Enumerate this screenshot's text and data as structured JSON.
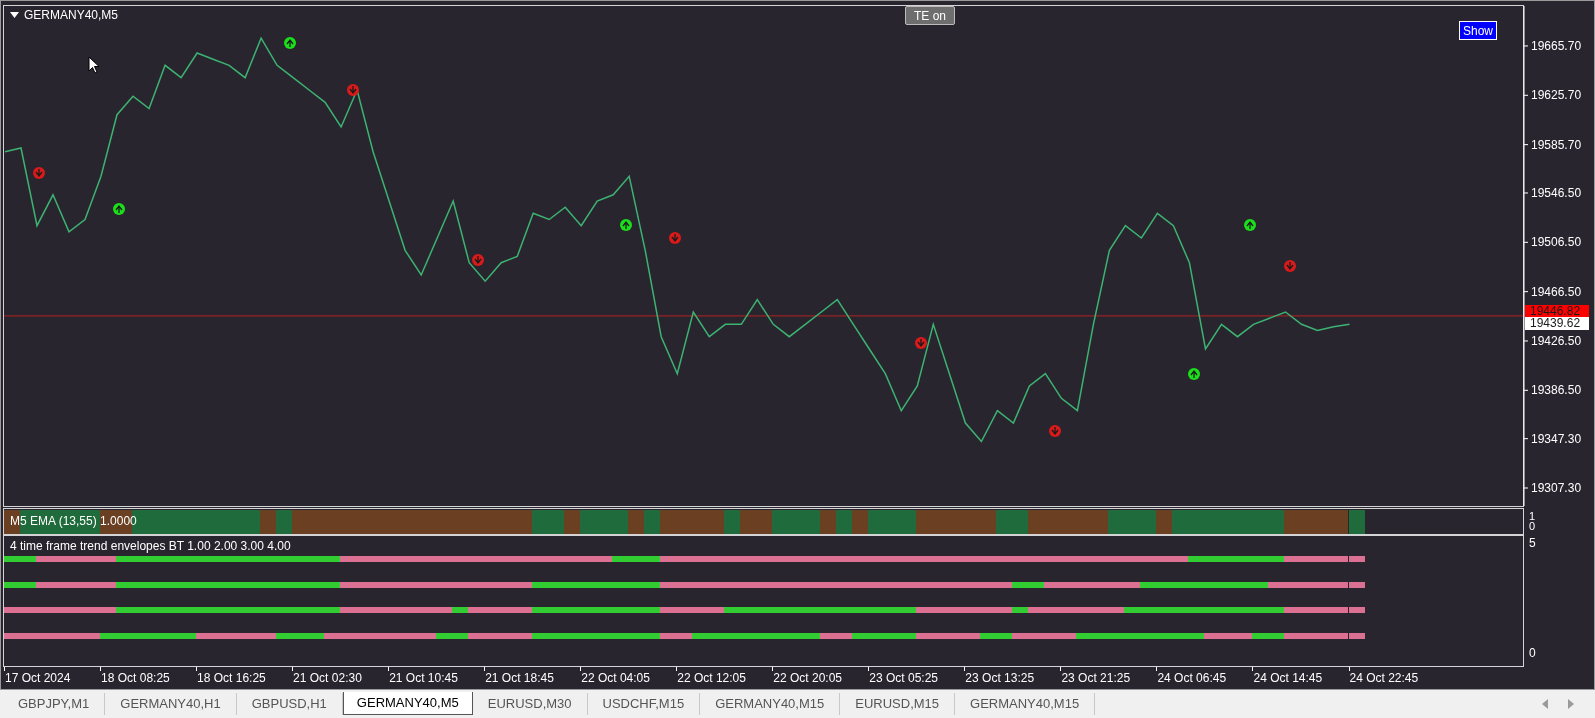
{
  "chart_window": {
    "title": "GERMANY40,M5",
    "te_button": "TE on",
    "show_button": "Show",
    "price_pane": {
      "ask_label": "19439.62",
      "chart_data": {
        "type": "line",
        "ylim": [
          19292.7,
          19698.1
        ],
        "yticks": [
          {
            "value": 19665.7,
            "label": "19665.70"
          },
          {
            "value": 19625.7,
            "label": "19625.70"
          },
          {
            "value": 19585.7,
            "label": "19585.70"
          },
          {
            "value": 19546.5,
            "label": "19546.50"
          },
          {
            "value": 19506.5,
            "label": "19506.50"
          },
          {
            "value": 19466.5,
            "label": "19466.50"
          },
          {
            "value": 19426.5,
            "label": "19426.50"
          },
          {
            "value": 19386.5,
            "label": "19386.50"
          },
          {
            "value": 19347.3,
            "label": "19347.30"
          },
          {
            "value": 19307.3,
            "label": "19307.30"
          }
        ],
        "series": [
          {
            "color": "#3cb371",
            "values": [
              19580,
              19583,
              19520,
              19545,
              19515,
              19525,
              19560,
              19610,
              19625,
              19615,
              19650,
              19640,
              19660,
              19655,
              19650,
              19640,
              19672,
              19650,
              19640,
              19630,
              19620,
              19600,
              19630,
              19580,
              19540,
              19500,
              19480,
              19510,
              19540,
              19490,
              19475,
              19490,
              19495,
              19530,
              19525,
              19535,
              19520,
              19540,
              19545,
              19560,
              19500,
              19430,
              19400,
              19450,
              19430,
              19440,
              19440,
              19460,
              19440,
              19430,
              19440,
              19450,
              19460,
              19440,
              19420,
              19400,
              19370,
              19390,
              19440,
              19400,
              19360,
              19345,
              19370,
              19360,
              19390,
              19400,
              19380,
              19370,
              19440,
              19500,
              19520,
              19510,
              19530,
              19520,
              19490,
              19420,
              19440,
              19430,
              19440,
              19445,
              19450,
              19440,
              19435,
              19438,
              19440
            ]
          }
        ],
        "ref_lines": [
          {
            "axis": "y",
            "value": 19446.82,
            "label": "19446.82"
          }
        ]
      }
    },
    "ema_pane": {
      "title": "M5 EMA (13,55) 1.0000",
      "scale": [
        "1",
        "0"
      ],
      "cells": [
        {
          "color": "#6b3f22"
        },
        {
          "color": "#1f6b3b"
        },
        {
          "color": "#1f6b3b"
        },
        {
          "color": "#1f6b3b"
        },
        {
          "color": "#1f6b3b"
        },
        {
          "color": "#1f6b3b"
        },
        {
          "color": "#6b3f22"
        },
        {
          "color": "#6b3f22"
        },
        {
          "color": "#1f6b3b"
        },
        {
          "color": "#1f6b3b"
        },
        {
          "color": "#1f6b3b"
        },
        {
          "color": "#1f6b3b"
        },
        {
          "color": "#1f6b3b"
        },
        {
          "color": "#1f6b3b"
        },
        {
          "color": "#1f6b3b"
        },
        {
          "color": "#1f6b3b"
        },
        {
          "color": "#6b3f22"
        },
        {
          "color": "#1f6b3b"
        },
        {
          "color": "#6b3f22"
        },
        {
          "color": "#6b3f22"
        },
        {
          "color": "#6b3f22"
        },
        {
          "color": "#6b3f22"
        },
        {
          "color": "#6b3f22"
        },
        {
          "color": "#6b3f22"
        },
        {
          "color": "#6b3f22"
        },
        {
          "color": "#6b3f22"
        },
        {
          "color": "#6b3f22"
        },
        {
          "color": "#6b3f22"
        },
        {
          "color": "#6b3f22"
        },
        {
          "color": "#6b3f22"
        },
        {
          "color": "#6b3f22"
        },
        {
          "color": "#6b3f22"
        },
        {
          "color": "#6b3f22"
        },
        {
          "color": "#1f6b3b"
        },
        {
          "color": "#1f6b3b"
        },
        {
          "color": "#6b3f22"
        },
        {
          "color": "#1f6b3b"
        },
        {
          "color": "#1f6b3b"
        },
        {
          "color": "#1f6b3b"
        },
        {
          "color": "#6b3f22"
        },
        {
          "color": "#1f6b3b"
        },
        {
          "color": "#6b3f22"
        },
        {
          "color": "#6b3f22"
        },
        {
          "color": "#6b3f22"
        },
        {
          "color": "#6b3f22"
        },
        {
          "color": "#1f6b3b"
        },
        {
          "color": "#6b3f22"
        },
        {
          "color": "#6b3f22"
        },
        {
          "color": "#1f6b3b"
        },
        {
          "color": "#1f6b3b"
        },
        {
          "color": "#1f6b3b"
        },
        {
          "color": "#6b3f22"
        },
        {
          "color": "#1f6b3b"
        },
        {
          "color": "#6b3f22"
        },
        {
          "color": "#1f6b3b"
        },
        {
          "color": "#1f6b3b"
        },
        {
          "color": "#1f6b3b"
        },
        {
          "color": "#6b3f22"
        },
        {
          "color": "#6b3f22"
        },
        {
          "color": "#6b3f22"
        },
        {
          "color": "#6b3f22"
        },
        {
          "color": "#6b3f22"
        },
        {
          "color": "#1f6b3b"
        },
        {
          "color": "#1f6b3b"
        },
        {
          "color": "#6b3f22"
        },
        {
          "color": "#6b3f22"
        },
        {
          "color": "#6b3f22"
        },
        {
          "color": "#6b3f22"
        },
        {
          "color": "#6b3f22"
        },
        {
          "color": "#1f6b3b"
        },
        {
          "color": "#1f6b3b"
        },
        {
          "color": "#1f6b3b"
        },
        {
          "color": "#6b3f22"
        },
        {
          "color": "#1f6b3b"
        },
        {
          "color": "#1f6b3b"
        },
        {
          "color": "#1f6b3b"
        },
        {
          "color": "#1f6b3b"
        },
        {
          "color": "#1f6b3b"
        },
        {
          "color": "#1f6b3b"
        },
        {
          "color": "#1f6b3b"
        },
        {
          "color": "#6b3f22"
        },
        {
          "color": "#6b3f22"
        },
        {
          "color": "#6b3f22"
        },
        {
          "color": "#6b3f22"
        },
        {
          "color": "#1f6b3b"
        }
      ]
    },
    "trend_pane": {
      "title": "4 time frame trend envelopes BT 1.00 2.00 3.00 4.00",
      "scale": [
        "5",
        "0"
      ],
      "lines": [
        {
          "cells": [
            {
              "color": "#32cd32"
            },
            {
              "color": "#32cd32"
            },
            {
              "color": "#db7093"
            },
            {
              "color": "#db7093"
            },
            {
              "color": "#db7093"
            },
            {
              "color": "#db7093"
            },
            {
              "color": "#db7093"
            },
            {
              "color": "#32cd32"
            },
            {
              "color": "#32cd32"
            },
            {
              "color": "#32cd32"
            },
            {
              "color": "#32cd32"
            },
            {
              "color": "#32cd32"
            },
            {
              "color": "#32cd32"
            },
            {
              "color": "#32cd32"
            },
            {
              "color": "#32cd32"
            },
            {
              "color": "#32cd32"
            },
            {
              "color": "#32cd32"
            },
            {
              "color": "#32cd32"
            },
            {
              "color": "#32cd32"
            },
            {
              "color": "#32cd32"
            },
            {
              "color": "#32cd32"
            },
            {
              "color": "#db7093"
            },
            {
              "color": "#db7093"
            },
            {
              "color": "#db7093"
            },
            {
              "color": "#db7093"
            },
            {
              "color": "#db7093"
            },
            {
              "color": "#db7093"
            },
            {
              "color": "#db7093"
            },
            {
              "color": "#db7093"
            },
            {
              "color": "#db7093"
            },
            {
              "color": "#db7093"
            },
            {
              "color": "#db7093"
            },
            {
              "color": "#db7093"
            },
            {
              "color": "#db7093"
            },
            {
              "color": "#db7093"
            },
            {
              "color": "#db7093"
            },
            {
              "color": "#db7093"
            },
            {
              "color": "#db7093"
            },
            {
              "color": "#32cd32"
            },
            {
              "color": "#32cd32"
            },
            {
              "color": "#32cd32"
            },
            {
              "color": "#db7093"
            },
            {
              "color": "#db7093"
            },
            {
              "color": "#db7093"
            },
            {
              "color": "#db7093"
            },
            {
              "color": "#db7093"
            },
            {
              "color": "#db7093"
            },
            {
              "color": "#db7093"
            },
            {
              "color": "#db7093"
            },
            {
              "color": "#db7093"
            },
            {
              "color": "#db7093"
            },
            {
              "color": "#db7093"
            },
            {
              "color": "#db7093"
            },
            {
              "color": "#db7093"
            },
            {
              "color": "#db7093"
            },
            {
              "color": "#db7093"
            },
            {
              "color": "#db7093"
            },
            {
              "color": "#db7093"
            },
            {
              "color": "#db7093"
            },
            {
              "color": "#db7093"
            },
            {
              "color": "#db7093"
            },
            {
              "color": "#db7093"
            },
            {
              "color": "#db7093"
            },
            {
              "color": "#db7093"
            },
            {
              "color": "#db7093"
            },
            {
              "color": "#db7093"
            },
            {
              "color": "#db7093"
            },
            {
              "color": "#db7093"
            },
            {
              "color": "#db7093"
            },
            {
              "color": "#db7093"
            },
            {
              "color": "#db7093"
            },
            {
              "color": "#db7093"
            },
            {
              "color": "#db7093"
            },
            {
              "color": "#db7093"
            },
            {
              "color": "#32cd32"
            },
            {
              "color": "#32cd32"
            },
            {
              "color": "#32cd32"
            },
            {
              "color": "#32cd32"
            },
            {
              "color": "#32cd32"
            },
            {
              "color": "#32cd32"
            },
            {
              "color": "#db7093"
            },
            {
              "color": "#db7093"
            },
            {
              "color": "#db7093"
            },
            {
              "color": "#db7093"
            },
            {
              "color": "#db7093"
            }
          ]
        },
        {
          "cells": [
            {
              "color": "#32cd32"
            },
            {
              "color": "#32cd32"
            },
            {
              "color": "#db7093"
            },
            {
              "color": "#db7093"
            },
            {
              "color": "#db7093"
            },
            {
              "color": "#db7093"
            },
            {
              "color": "#db7093"
            },
            {
              "color": "#32cd32"
            },
            {
              "color": "#32cd32"
            },
            {
              "color": "#32cd32"
            },
            {
              "color": "#32cd32"
            },
            {
              "color": "#32cd32"
            },
            {
              "color": "#32cd32"
            },
            {
              "color": "#32cd32"
            },
            {
              "color": "#32cd32"
            },
            {
              "color": "#32cd32"
            },
            {
              "color": "#32cd32"
            },
            {
              "color": "#32cd32"
            },
            {
              "color": "#32cd32"
            },
            {
              "color": "#32cd32"
            },
            {
              "color": "#32cd32"
            },
            {
              "color": "#db7093"
            },
            {
              "color": "#db7093"
            },
            {
              "color": "#db7093"
            },
            {
              "color": "#db7093"
            },
            {
              "color": "#db7093"
            },
            {
              "color": "#db7093"
            },
            {
              "color": "#db7093"
            },
            {
              "color": "#db7093"
            },
            {
              "color": "#db7093"
            },
            {
              "color": "#db7093"
            },
            {
              "color": "#db7093"
            },
            {
              "color": "#db7093"
            },
            {
              "color": "#32cd32"
            },
            {
              "color": "#32cd32"
            },
            {
              "color": "#32cd32"
            },
            {
              "color": "#32cd32"
            },
            {
              "color": "#32cd32"
            },
            {
              "color": "#32cd32"
            },
            {
              "color": "#32cd32"
            },
            {
              "color": "#32cd32"
            },
            {
              "color": "#db7093"
            },
            {
              "color": "#db7093"
            },
            {
              "color": "#db7093"
            },
            {
              "color": "#db7093"
            },
            {
              "color": "#db7093"
            },
            {
              "color": "#db7093"
            },
            {
              "color": "#db7093"
            },
            {
              "color": "#db7093"
            },
            {
              "color": "#db7093"
            },
            {
              "color": "#db7093"
            },
            {
              "color": "#db7093"
            },
            {
              "color": "#db7093"
            },
            {
              "color": "#db7093"
            },
            {
              "color": "#db7093"
            },
            {
              "color": "#db7093"
            },
            {
              "color": "#db7093"
            },
            {
              "color": "#db7093"
            },
            {
              "color": "#db7093"
            },
            {
              "color": "#db7093"
            },
            {
              "color": "#db7093"
            },
            {
              "color": "#db7093"
            },
            {
              "color": "#db7093"
            },
            {
              "color": "#32cd32"
            },
            {
              "color": "#32cd32"
            },
            {
              "color": "#db7093"
            },
            {
              "color": "#db7093"
            },
            {
              "color": "#db7093"
            },
            {
              "color": "#db7093"
            },
            {
              "color": "#db7093"
            },
            {
              "color": "#db7093"
            },
            {
              "color": "#32cd32"
            },
            {
              "color": "#32cd32"
            },
            {
              "color": "#32cd32"
            },
            {
              "color": "#32cd32"
            },
            {
              "color": "#32cd32"
            },
            {
              "color": "#32cd32"
            },
            {
              "color": "#32cd32"
            },
            {
              "color": "#32cd32"
            },
            {
              "color": "#db7093"
            },
            {
              "color": "#db7093"
            },
            {
              "color": "#db7093"
            },
            {
              "color": "#db7093"
            },
            {
              "color": "#db7093"
            },
            {
              "color": "#db7093"
            }
          ]
        },
        {
          "cells": [
            {
              "color": "#db7093"
            },
            {
              "color": "#db7093"
            },
            {
              "color": "#db7093"
            },
            {
              "color": "#db7093"
            },
            {
              "color": "#db7093"
            },
            {
              "color": "#db7093"
            },
            {
              "color": "#db7093"
            },
            {
              "color": "#32cd32"
            },
            {
              "color": "#32cd32"
            },
            {
              "color": "#32cd32"
            },
            {
              "color": "#32cd32"
            },
            {
              "color": "#32cd32"
            },
            {
              "color": "#32cd32"
            },
            {
              "color": "#32cd32"
            },
            {
              "color": "#32cd32"
            },
            {
              "color": "#32cd32"
            },
            {
              "color": "#32cd32"
            },
            {
              "color": "#32cd32"
            },
            {
              "color": "#32cd32"
            },
            {
              "color": "#32cd32"
            },
            {
              "color": "#32cd32"
            },
            {
              "color": "#db7093"
            },
            {
              "color": "#db7093"
            },
            {
              "color": "#db7093"
            },
            {
              "color": "#db7093"
            },
            {
              "color": "#db7093"
            },
            {
              "color": "#db7093"
            },
            {
              "color": "#db7093"
            },
            {
              "color": "#32cd32"
            },
            {
              "color": "#db7093"
            },
            {
              "color": "#db7093"
            },
            {
              "color": "#db7093"
            },
            {
              "color": "#db7093"
            },
            {
              "color": "#32cd32"
            },
            {
              "color": "#32cd32"
            },
            {
              "color": "#32cd32"
            },
            {
              "color": "#32cd32"
            },
            {
              "color": "#32cd32"
            },
            {
              "color": "#32cd32"
            },
            {
              "color": "#32cd32"
            },
            {
              "color": "#32cd32"
            },
            {
              "color": "#db7093"
            },
            {
              "color": "#db7093"
            },
            {
              "color": "#db7093"
            },
            {
              "color": "#db7093"
            },
            {
              "color": "#32cd32"
            },
            {
              "color": "#32cd32"
            },
            {
              "color": "#32cd32"
            },
            {
              "color": "#32cd32"
            },
            {
              "color": "#32cd32"
            },
            {
              "color": "#32cd32"
            },
            {
              "color": "#32cd32"
            },
            {
              "color": "#32cd32"
            },
            {
              "color": "#32cd32"
            },
            {
              "color": "#32cd32"
            },
            {
              "color": "#32cd32"
            },
            {
              "color": "#32cd32"
            },
            {
              "color": "#db7093"
            },
            {
              "color": "#db7093"
            },
            {
              "color": "#db7093"
            },
            {
              "color": "#db7093"
            },
            {
              "color": "#db7093"
            },
            {
              "color": "#db7093"
            },
            {
              "color": "#32cd32"
            },
            {
              "color": "#db7093"
            },
            {
              "color": "#db7093"
            },
            {
              "color": "#db7093"
            },
            {
              "color": "#db7093"
            },
            {
              "color": "#db7093"
            },
            {
              "color": "#db7093"
            },
            {
              "color": "#32cd32"
            },
            {
              "color": "#32cd32"
            },
            {
              "color": "#32cd32"
            },
            {
              "color": "#32cd32"
            },
            {
              "color": "#32cd32"
            },
            {
              "color": "#32cd32"
            },
            {
              "color": "#32cd32"
            },
            {
              "color": "#32cd32"
            },
            {
              "color": "#32cd32"
            },
            {
              "color": "#32cd32"
            },
            {
              "color": "#db7093"
            },
            {
              "color": "#db7093"
            },
            {
              "color": "#db7093"
            },
            {
              "color": "#db7093"
            },
            {
              "color": "#db7093"
            }
          ]
        },
        {
          "cells": [
            {
              "color": "#db7093"
            },
            {
              "color": "#db7093"
            },
            {
              "color": "#db7093"
            },
            {
              "color": "#db7093"
            },
            {
              "color": "#db7093"
            },
            {
              "color": "#db7093"
            },
            {
              "color": "#32cd32"
            },
            {
              "color": "#32cd32"
            },
            {
              "color": "#32cd32"
            },
            {
              "color": "#32cd32"
            },
            {
              "color": "#32cd32"
            },
            {
              "color": "#32cd32"
            },
            {
              "color": "#db7093"
            },
            {
              "color": "#db7093"
            },
            {
              "color": "#db7093"
            },
            {
              "color": "#db7093"
            },
            {
              "color": "#db7093"
            },
            {
              "color": "#32cd32"
            },
            {
              "color": "#32cd32"
            },
            {
              "color": "#32cd32"
            },
            {
              "color": "#db7093"
            },
            {
              "color": "#db7093"
            },
            {
              "color": "#db7093"
            },
            {
              "color": "#db7093"
            },
            {
              "color": "#db7093"
            },
            {
              "color": "#db7093"
            },
            {
              "color": "#db7093"
            },
            {
              "color": "#32cd32"
            },
            {
              "color": "#32cd32"
            },
            {
              "color": "#db7093"
            },
            {
              "color": "#db7093"
            },
            {
              "color": "#db7093"
            },
            {
              "color": "#db7093"
            },
            {
              "color": "#32cd32"
            },
            {
              "color": "#32cd32"
            },
            {
              "color": "#32cd32"
            },
            {
              "color": "#32cd32"
            },
            {
              "color": "#32cd32"
            },
            {
              "color": "#32cd32"
            },
            {
              "color": "#32cd32"
            },
            {
              "color": "#32cd32"
            },
            {
              "color": "#db7093"
            },
            {
              "color": "#db7093"
            },
            {
              "color": "#32cd32"
            },
            {
              "color": "#32cd32"
            },
            {
              "color": "#32cd32"
            },
            {
              "color": "#32cd32"
            },
            {
              "color": "#32cd32"
            },
            {
              "color": "#32cd32"
            },
            {
              "color": "#32cd32"
            },
            {
              "color": "#32cd32"
            },
            {
              "color": "#db7093"
            },
            {
              "color": "#db7093"
            },
            {
              "color": "#32cd32"
            },
            {
              "color": "#32cd32"
            },
            {
              "color": "#32cd32"
            },
            {
              "color": "#32cd32"
            },
            {
              "color": "#db7093"
            },
            {
              "color": "#db7093"
            },
            {
              "color": "#db7093"
            },
            {
              "color": "#db7093"
            },
            {
              "color": "#32cd32"
            },
            {
              "color": "#32cd32"
            },
            {
              "color": "#db7093"
            },
            {
              "color": "#db7093"
            },
            {
              "color": "#db7093"
            },
            {
              "color": "#db7093"
            },
            {
              "color": "#32cd32"
            },
            {
              "color": "#32cd32"
            },
            {
              "color": "#32cd32"
            },
            {
              "color": "#32cd32"
            },
            {
              "color": "#32cd32"
            },
            {
              "color": "#32cd32"
            },
            {
              "color": "#32cd32"
            },
            {
              "color": "#32cd32"
            },
            {
              "color": "#db7093"
            },
            {
              "color": "#db7093"
            },
            {
              "color": "#db7093"
            },
            {
              "color": "#32cd32"
            },
            {
              "color": "#32cd32"
            },
            {
              "color": "#db7093"
            },
            {
              "color": "#db7093"
            },
            {
              "color": "#db7093"
            },
            {
              "color": "#db7093"
            },
            {
              "color": "#db7093"
            }
          ]
        }
      ]
    }
  },
  "time_axis": [
    "17 Oct 2024",
    "18 Oct 08:25",
    "18 Oct 16:25",
    "21 Oct 02:30",
    "21 Oct 10:45",
    "21 Oct 18:45",
    "22 Oct 04:05",
    "22 Oct 12:05",
    "22 Oct 20:05",
    "23 Oct 05:25",
    "23 Oct 13:25",
    "23 Oct 21:25",
    "24 Oct 06:45",
    "24 Oct 14:45",
    "24 Oct 22:45"
  ],
  "tabs": [
    {
      "label": "GBPJPY,M1",
      "selected": false
    },
    {
      "label": "GERMANY40,H1",
      "selected": false
    },
    {
      "label": "GBPUSD,H1",
      "selected": false
    },
    {
      "label": "GERMANY40,M5",
      "selected": true
    },
    {
      "label": "EURUSD,M30",
      "selected": false
    },
    {
      "label": "USDCHF,M15",
      "selected": false
    },
    {
      "label": "GERMANY40,M15",
      "selected": false
    },
    {
      "label": "EURUSD,M15",
      "selected": false
    },
    {
      "label": "GERMANY40,M15",
      "selected": false
    }
  ]
}
